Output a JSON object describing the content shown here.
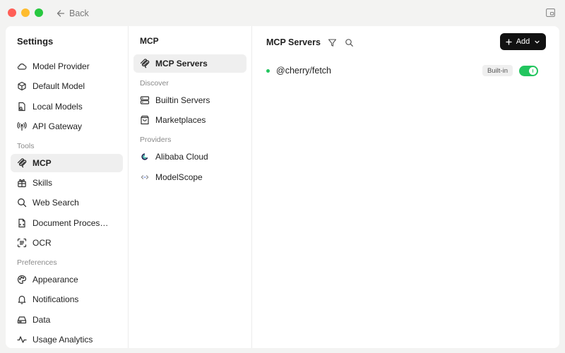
{
  "titlebar": {
    "back_label": "Back"
  },
  "sidebar": {
    "title": "Settings",
    "items": [
      {
        "label": "Model Provider",
        "icon": "cloud-icon"
      },
      {
        "label": "Default Model",
        "icon": "cube-icon"
      },
      {
        "label": "Local Models",
        "icon": "local-models-icon"
      },
      {
        "label": "API Gateway",
        "icon": "antenna-icon"
      }
    ],
    "tools_label": "Tools",
    "tools": [
      {
        "label": "MCP",
        "icon": "mcp-icon",
        "active": true
      },
      {
        "label": "Skills",
        "icon": "skills-icon"
      },
      {
        "label": "Web Search",
        "icon": "search-icon"
      },
      {
        "label": "Document Proces…",
        "icon": "document-icon"
      },
      {
        "label": "OCR",
        "icon": "scan-icon"
      }
    ],
    "preferences_label": "Preferences",
    "preferences": [
      {
        "label": "Appearance",
        "icon": "palette-icon"
      },
      {
        "label": "Notifications",
        "icon": "bell-icon"
      },
      {
        "label": "Data",
        "icon": "drive-icon"
      },
      {
        "label": "Usage Analytics",
        "icon": "activity-icon"
      }
    ]
  },
  "mid": {
    "title": "MCP",
    "servers": {
      "label": "MCP Servers",
      "icon": "mcp-icon",
      "active": true
    },
    "discover_label": "Discover",
    "discover": [
      {
        "label": "Builtin Servers",
        "icon": "server-icon"
      },
      {
        "label": "Marketplaces",
        "icon": "bag-icon"
      }
    ],
    "providers_label": "Providers",
    "providers": [
      {
        "label": "Alibaba Cloud",
        "icon": "alibaba-cloud-logo"
      },
      {
        "label": "ModelScope",
        "icon": "modelscope-logo"
      }
    ]
  },
  "main": {
    "title": "MCP Servers",
    "add_label": "Add",
    "server": {
      "name": "@cherry/fetch",
      "badge": "Built-in",
      "enabled": true
    },
    "colors": {
      "accent": "#22c55e",
      "button": "#111111"
    }
  }
}
